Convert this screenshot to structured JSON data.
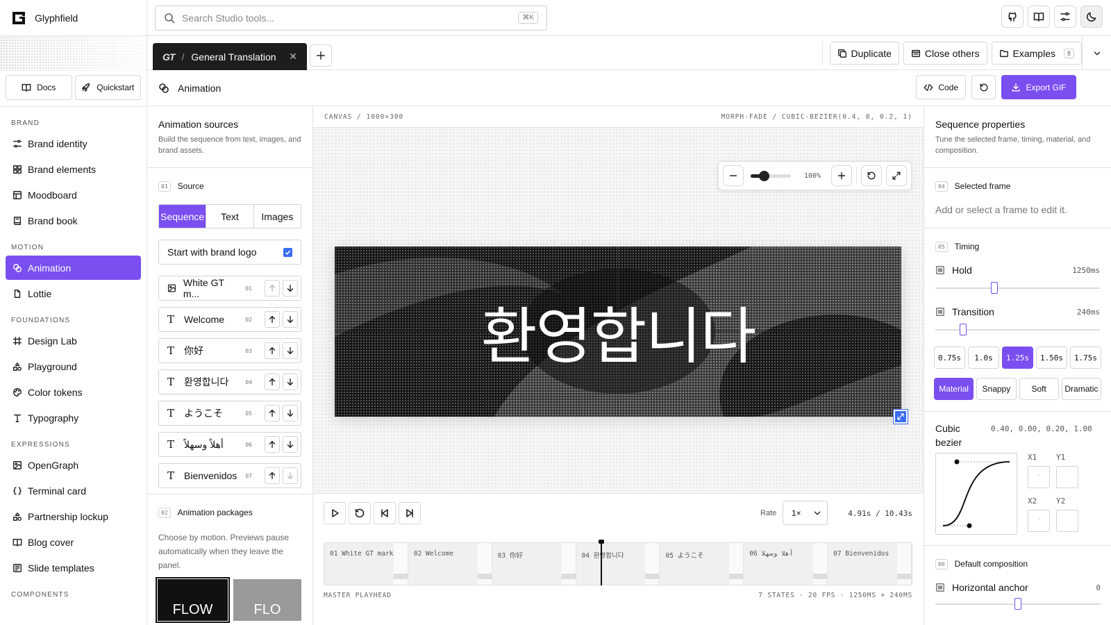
{
  "app": {
    "name": "Glyphfield"
  },
  "sidebar": {
    "docs_label": "Docs",
    "quickstart_label": "Quickstart",
    "sections": [
      {
        "title": "BRAND",
        "items": [
          {
            "label": "Brand identity",
            "icon": "sliders-icon"
          },
          {
            "label": "Brand elements",
            "icon": "grid-icon"
          },
          {
            "label": "Moodboard",
            "icon": "layout-icon"
          },
          {
            "label": "Brand book",
            "icon": "book-icon"
          }
        ]
      },
      {
        "title": "MOTION",
        "items": [
          {
            "label": "Animation",
            "icon": "orbit-icon",
            "active": true
          },
          {
            "label": "Lottie",
            "icon": "file-icon"
          }
        ]
      },
      {
        "title": "FOUNDATIONS",
        "items": [
          {
            "label": "Design Lab",
            "icon": "hash-icon"
          },
          {
            "label": "Playground",
            "icon": "shapes-icon"
          },
          {
            "label": "Color tokens",
            "icon": "palette-icon"
          },
          {
            "label": "Typography",
            "icon": "type-icon"
          }
        ]
      },
      {
        "title": "EXPRESSIONS",
        "items": [
          {
            "label": "OpenGraph",
            "icon": "image-icon"
          },
          {
            "label": "Terminal card",
            "icon": "braces-icon"
          },
          {
            "label": "Partnership lockup",
            "icon": "shapes-icon"
          },
          {
            "label": "Blog cover",
            "icon": "book-open-icon"
          },
          {
            "label": "Slide templates",
            "icon": "slides-icon"
          }
        ]
      },
      {
        "title": "COMPONENTS",
        "items": []
      }
    ]
  },
  "topbar": {
    "search_placeholder": "Search Studio tools...",
    "shortcut": "⌘K"
  },
  "tabbar": {
    "tab_icon": "GT",
    "tab_sep": "/",
    "tab_title": "General Translation",
    "duplicate_label": "Duplicate",
    "close_others_label": "Close others",
    "examples_label": "Examples",
    "examples_count": "8"
  },
  "page_header": {
    "title": "Animation",
    "code_label": "Code",
    "export_label": "Export GIF"
  },
  "left_panel": {
    "title": "Animation sources",
    "description": "Build the sequence from text, images, and brand assets.",
    "source_num": "01",
    "source_title": "Source",
    "segments": [
      {
        "label": "Sequence",
        "active": true
      },
      {
        "label": "Text",
        "active": false
      },
      {
        "label": "Images",
        "active": false
      }
    ],
    "brand_logo_label": "Start with brand logo",
    "brand_logo_checked": true,
    "items": [
      {
        "kind": "image",
        "label": "White GT m...",
        "num": "01"
      },
      {
        "kind": "text",
        "label": "Welcome",
        "num": "02"
      },
      {
        "kind": "text",
        "label": "你好",
        "num": "03"
      },
      {
        "kind": "text",
        "label": "환영합니다",
        "num": "04"
      },
      {
        "kind": "text",
        "label": "ようこそ",
        "num": "05"
      },
      {
        "kind": "text",
        "label": "أهلاً وسهلاً",
        "num": "06"
      },
      {
        "kind": "text",
        "label": "Bienvenidos",
        "num": "07"
      }
    ],
    "type_glyph": "T",
    "packages_num": "02",
    "packages_title": "Animation packages",
    "packages_description": "Choose by motion. Previews pause automatically when they leave the panel.",
    "package_thumbs": [
      "FLOW",
      "FLO"
    ]
  },
  "canvas": {
    "header_left": "CANVAS / 1000×300",
    "header_right": "MORPH-FADE / CUBIC-BEZIER(0.4, 0, 0.2, 1)",
    "zoom_pct": "100%",
    "zoom_level": 0.33,
    "stage_text": "환영합니다"
  },
  "transport": {
    "rate_label": "Rate",
    "rate_value": "1×",
    "time_readout": "4.91s / 10.43s"
  },
  "timeline": {
    "frames": [
      "01 White GT mark",
      "02 Welcome",
      "03 你好",
      "04 환영합니다",
      "05 ようこそ",
      "06 أهلا وسهلا",
      "07 Bienvenidos"
    ],
    "playhead_fraction": 0.471,
    "footer_left": "MASTER PLAYHEAD",
    "footer_right": "7 STATES · 20 FPS · 1250MS + 240MS"
  },
  "right_panel": {
    "title": "Sequence properties",
    "description": "Tune the selected frame, timing, material, and composition.",
    "selected_num": "04",
    "selected_title": "Selected frame",
    "selected_empty": "Add or select a frame to edit it.",
    "timing_num": "05",
    "timing_title": "Timing",
    "hold_label": "Hold",
    "hold_value": "1250ms",
    "hold_level": 0.36,
    "transition_label": "Transition",
    "transition_value": "240ms",
    "transition_level": 0.17,
    "durations": [
      {
        "label": "0.75s",
        "active": false
      },
      {
        "label": "1.0s",
        "active": false
      },
      {
        "label": "1.25s",
        "active": true
      },
      {
        "label": "1.50s",
        "active": false
      },
      {
        "label": "1.75s",
        "active": false
      }
    ],
    "styles": [
      {
        "label": "Material",
        "active": true
      },
      {
        "label": "Snappy",
        "active": false
      },
      {
        "label": "Soft",
        "active": false
      },
      {
        "label": "Dramatic",
        "active": false
      }
    ],
    "bezier_label": "Cubic bezier",
    "bezier_value": "0.40, 0.00, 0.20, 1.00",
    "x1_label": "X1",
    "y1_label": "Y1",
    "x2_label": "X2",
    "y2_label": "Y2",
    "composition_num": "06",
    "composition_title": "Default composition",
    "anchor_label": "Horizontal anchor",
    "anchor_value": "0",
    "anchor_level": 0.5
  },
  "colors": {
    "accent": "#7a4ff0",
    "checkbox": "#3b6cf0",
    "stage_bg": "#1a1a1a"
  }
}
